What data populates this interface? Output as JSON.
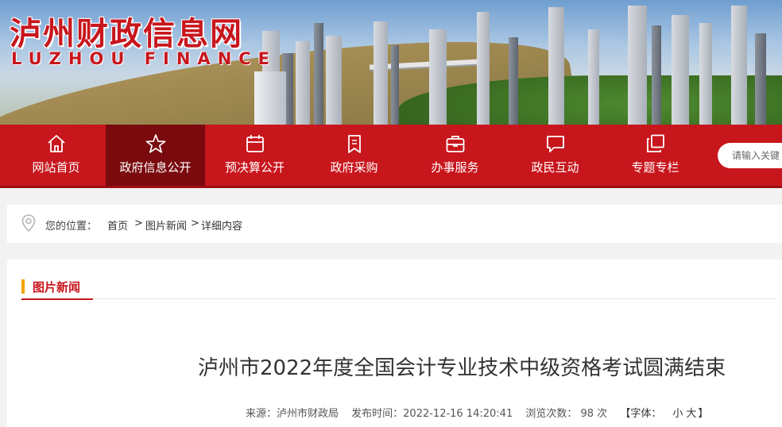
{
  "brand": {
    "title": "泸州财政信息网",
    "subtitle": "LUZHOU FINANCE"
  },
  "nav": {
    "items": [
      {
        "label": "网站首页",
        "icon": "home-icon"
      },
      {
        "label": "政府信息公开",
        "icon": "star-icon",
        "active": true
      },
      {
        "label": "预决算公开",
        "icon": "calendar-icon"
      },
      {
        "label": "政府采购",
        "icon": "bookmark-icon"
      },
      {
        "label": "办事服务",
        "icon": "briefcase-icon"
      },
      {
        "label": "政民互动",
        "icon": "chat-icon"
      },
      {
        "label": "专题专栏",
        "icon": "copy-icon"
      }
    ],
    "search_placeholder": "请输入关键"
  },
  "breadcrumb": {
    "label": "您的位置：",
    "home": "首页",
    "sep1": ">",
    "news": "图片新闻",
    "sep2": ">",
    "detail": "详细内容"
  },
  "section": {
    "title": "图片新闻"
  },
  "article": {
    "title": "泸州市2022年度全国会计专业技术中级资格考试圆满结束",
    "source": "来源：泸州市财政局",
    "published": "发布时间：2022-12-16 14:20:41",
    "views": "浏览次数： 98  次",
    "font_label_open": "【字体：",
    "font_small": "小",
    "font_large": "大",
    "font_label_close": "】"
  },
  "colors": {
    "primary_red": "#c8161d",
    "active_nav": "#7a0a0e",
    "accent_bar": "#f2a400"
  }
}
